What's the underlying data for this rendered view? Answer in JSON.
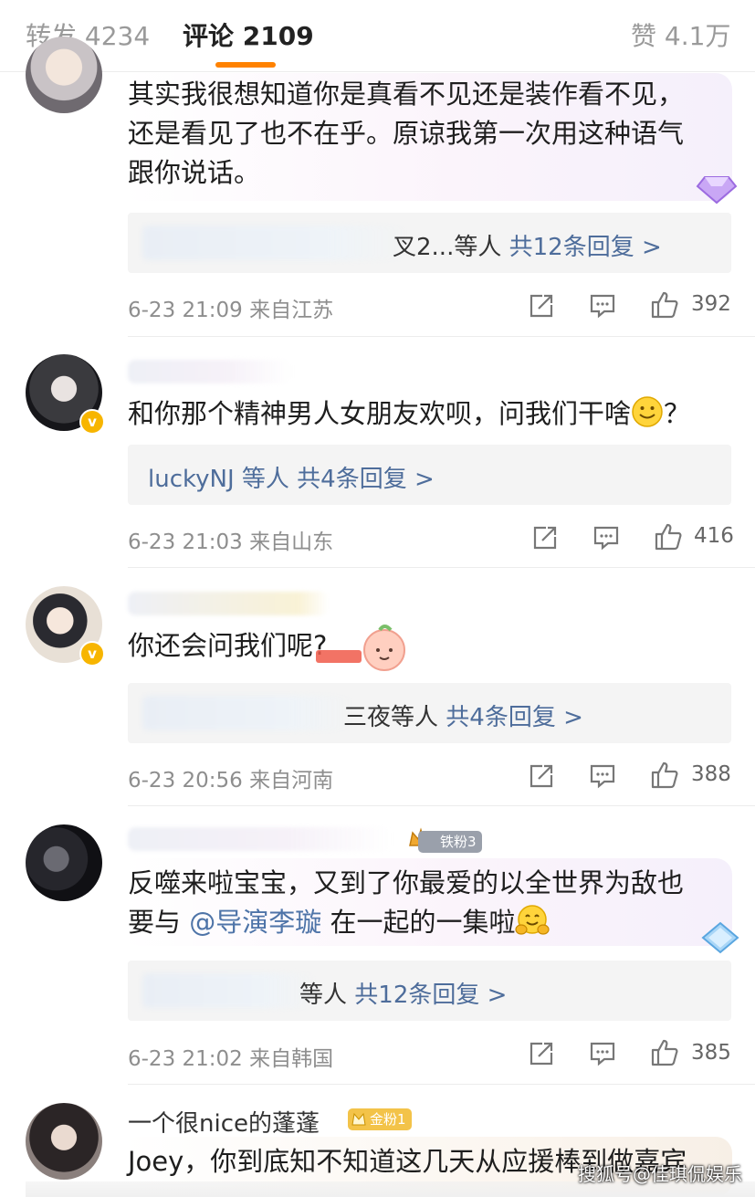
{
  "tabs": {
    "repost_label": "转发",
    "repost_count": "4234",
    "comment_label": "评论",
    "comment_count": "2109",
    "like_label": "赞",
    "like_count": "4.1万"
  },
  "comments": [
    {
      "lines": [
        "其实我很想知道你是真看不见还是装作看不见，",
        "还是看见了也不在乎。原谅我第一次用这种语气",
        "跟你说话。"
      ],
      "reply_names": "叉2...等人",
      "reply_link": "共12条回复 >",
      "time": "6-23 21:09",
      "location": "来自江苏",
      "likes": "392"
    },
    {
      "text": "和你那个精神男人女朋友欢呗，问我们干啥",
      "text_tail": "？",
      "reply_names": "luckyNJ 等人",
      "reply_link": "共4条回复 >",
      "time": "6-23 21:03",
      "location": "来自山东",
      "likes": "416"
    },
    {
      "text": "你还会问我们呢?",
      "reply_names": "三夜等人",
      "reply_link": "共4条回复 >",
      "time": "6-23 20:56",
      "location": "来自河南",
      "likes": "388"
    },
    {
      "badge": "铁粉3",
      "line1": "反噬来啦宝宝，又到了你最爱的以全世界为敌也",
      "line2_pre": "要与",
      "mention": "@导演李璇",
      "line2_post": "在一起的一集啦",
      "reply_names": "等人",
      "reply_link": "共12条回复 >",
      "time": "6-23 21:02",
      "location": "来自韩国",
      "likes": "385"
    },
    {
      "name": "一个很nice的蓬蓬",
      "badge": "金粉1",
      "text": "Joey，你到底知不知道这几天从应援棒到做嘉宾"
    }
  ],
  "watermark": "搜狐号@佳琪侃娱乐",
  "colors": {
    "accent": "#ff8200",
    "link": "#4e6d9b",
    "vip_badge": "#f7b500"
  }
}
